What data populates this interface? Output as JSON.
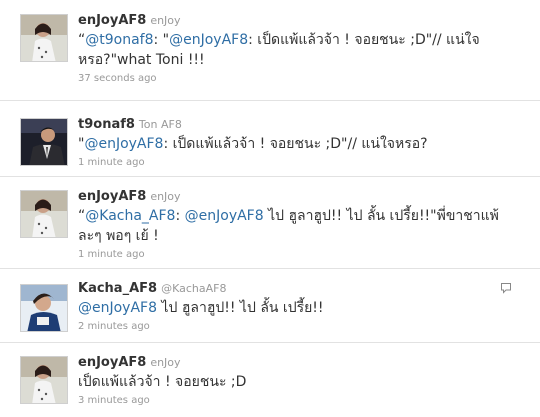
{
  "tweets": [
    {
      "screen_name": "enJoyAF8",
      "full_name": "enJoy",
      "time": "37 seconds ago",
      "parts": [
        {
          "t": "“",
          "m": false
        },
        {
          "t": "@t9onaf8",
          "m": true
        },
        {
          "t": ": \"",
          "m": false
        },
        {
          "t": "@enJoyAF8",
          "m": true
        },
        {
          "t": ": เป็ดแพ้แล้วจ้า ! จอยชนะ ;D\"// แน่ใจหรอ?\"what Toni !!!",
          "m": false
        }
      ]
    },
    {
      "screen_name": "t9onaf8",
      "full_name": "Ton AF8",
      "time": "1 minute ago",
      "parts": [
        {
          "t": "\"",
          "m": false
        },
        {
          "t": "@enJoyAF8",
          "m": true
        },
        {
          "t": ": เป็ดแพ้แล้วจ้า ! จอยชนะ ;D\"// แน่ใจหรอ?",
          "m": false
        }
      ]
    },
    {
      "screen_name": "enJoyAF8",
      "full_name": "enJoy",
      "time": "1 minute ago",
      "parts": [
        {
          "t": "“",
          "m": false
        },
        {
          "t": "@Kacha_AF8",
          "m": true
        },
        {
          "t": ": ",
          "m": false
        },
        {
          "t": "@enJoyAF8",
          "m": true
        },
        {
          "t": " ไป ฮูลาฮูป!! ไป ลั้น เปรี้ย!!\"พี่ขาชาแพ้ละๆ พอๆ เย้ !",
          "m": false
        }
      ]
    },
    {
      "screen_name": "Kacha_AF8",
      "full_name": "@KachaAF8",
      "time": "2 minutes ago",
      "parts": [
        {
          "t": "@enJoyAF8",
          "m": true
        },
        {
          "t": " ไป ฮูลาฮูป!! ไป ลั้น เปรี้ย!!",
          "m": false
        }
      ]
    },
    {
      "screen_name": "enJoyAF8",
      "full_name": "enJoy",
      "time": "3 minutes ago",
      "parts": [
        {
          "t": "เป็ดแพ้แล้วจ้า ! จอยชนะ ;D",
          "m": false
        }
      ]
    }
  ],
  "icons": {
    "reply": "reply-bubble-icon"
  },
  "colors": {
    "mention": "#2f6ea5",
    "meta": "#999999",
    "text": "#333333",
    "separator": "#e2e2e2"
  }
}
